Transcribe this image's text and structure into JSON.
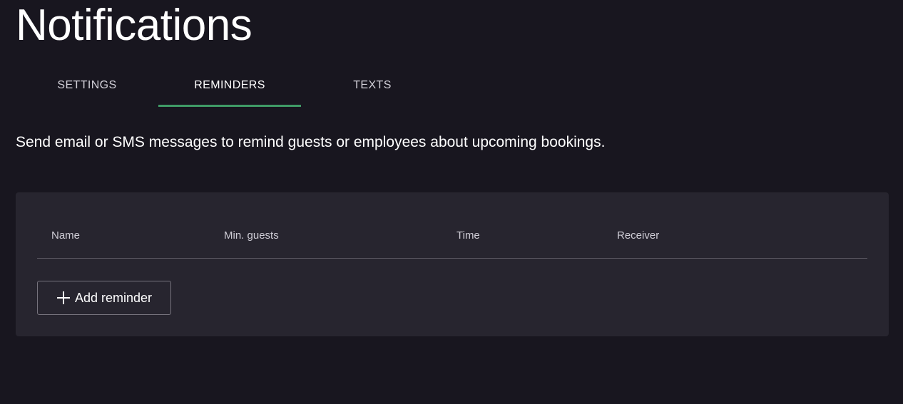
{
  "page": {
    "title": "Notifications",
    "description": "Send email or SMS messages to remind guests or employees about upcoming bookings."
  },
  "tabs": [
    {
      "label": "SETTINGS",
      "active": false
    },
    {
      "label": "REMINDERS",
      "active": true
    },
    {
      "label": "TEXTS",
      "active": false
    }
  ],
  "table": {
    "columns": [
      "Name",
      "Min. guests",
      "Time",
      "Receiver"
    ],
    "rows": []
  },
  "actions": {
    "add_reminder_label": "Add reminder",
    "add_icon": "plus-icon"
  },
  "colors": {
    "background": "#18161f",
    "card": "#27252f",
    "accent": "#3f9b66"
  }
}
